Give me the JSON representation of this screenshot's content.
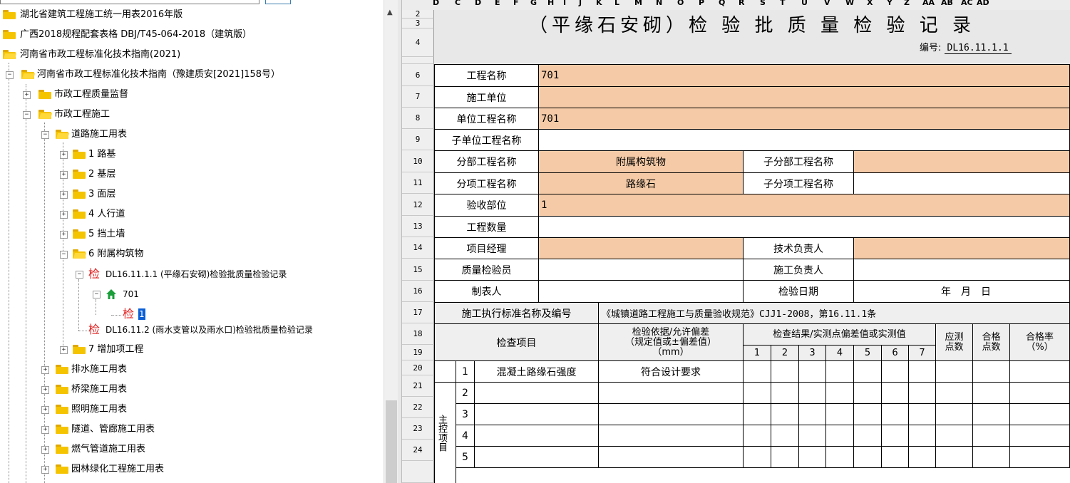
{
  "tree": {
    "items": [
      {
        "label": "湖北省建筑工程施工统一用表2016年版"
      },
      {
        "label": "广西2018规程配套表格 DBJ/T45-064-2018（建筑版）"
      },
      {
        "label": "河南省市政工程标准化技术指南(2021)"
      },
      {
        "label": "河南省市政工程标准化技术指南（豫建质安[2021]158号）"
      },
      {
        "label": "市政工程质量监督"
      },
      {
        "label": "市政工程施工"
      },
      {
        "label": "道路施工用表"
      },
      {
        "label": "1 路基"
      },
      {
        "label": "2 基层"
      },
      {
        "label": "3 面层"
      },
      {
        "label": "4 人行道"
      },
      {
        "label": "5 挡土墙"
      },
      {
        "label": "6 附属构筑物"
      },
      {
        "label": "DL16.11.1.1 (平缘石安砌)检验批质量检验记录"
      },
      {
        "label": "701"
      },
      {
        "label": "1"
      },
      {
        "label": "DL16.11.2 (雨水支管以及雨水口)检验批质量检验记录"
      },
      {
        "label": "7 增加项工程"
      },
      {
        "label": "排水施工用表"
      },
      {
        "label": "桥梁施工用表"
      },
      {
        "label": "照明施工用表"
      },
      {
        "label": "隧道、管廊施工用表"
      },
      {
        "label": "燃气管道施工用表"
      },
      {
        "label": "园林绿化工程施工用表"
      }
    ],
    "jian": "检"
  },
  "sheet": {
    "col_letters": [
      "D",
      "C",
      "D",
      "E",
      "F",
      "G",
      "H",
      "I",
      "J",
      "K",
      "L",
      "M",
      "N",
      "O",
      "P",
      "Q",
      "R",
      "S",
      "T",
      "U",
      "V",
      "W",
      "X",
      "Y",
      "Z",
      "AA",
      "AB",
      "AC",
      "AD"
    ],
    "row_numbers": [
      "2",
      "3",
      "4",
      "6",
      "7",
      "8",
      "9",
      "10",
      "11",
      "12",
      "13",
      "14",
      "15",
      "16",
      "17",
      "18",
      "19",
      "20",
      "21",
      "22",
      "23",
      "24"
    ],
    "title": "（平缘石安砌）检 验 批 质 量 检 验 记 录",
    "bianhao_label": "编号:",
    "bianhao_value": "DL16.11.1.1",
    "rows": {
      "gcmc": {
        "label": "工程名称",
        "value": "701"
      },
      "sgdw": {
        "label": "施工单位",
        "value": ""
      },
      "dwgc": {
        "label": "单位工程名称",
        "value": "701"
      },
      "zdw": {
        "label": "子单位工程名称",
        "value": ""
      },
      "fb": {
        "label": "分部工程名称",
        "value": "附属构筑物",
        "label2": "子分部工程名称"
      },
      "fx": {
        "label": "分项工程名称",
        "value": "路缘石",
        "label2": "子分项工程名称"
      },
      "ys": {
        "label": "验收部位",
        "value": "1"
      },
      "sl": {
        "label": "工程数量",
        "value": ""
      },
      "xm": {
        "label": "项目经理",
        "label2": "技术负责人"
      },
      "zl": {
        "label": "质量检验员",
        "label2": "施工负责人"
      },
      "zb": {
        "label": "制表人",
        "label2": "检验日期",
        "date": "年　月　日"
      },
      "bz": {
        "label": "施工执行标准名称及编号",
        "value": "《城镇道路工程施工与质量验收规范》CJJ1-2008，第16.11.1条"
      }
    },
    "header": {
      "jcxm": "检查项目",
      "yiju": "检验依据/允许偏差",
      "yiju2": "（规定值或±偏差值）",
      "unit": "（mm）",
      "result": "检查结果/实测点偏差值或实测值",
      "points": [
        "1",
        "2",
        "3",
        "4",
        "5",
        "6",
        "7"
      ],
      "ycds": "应测点数",
      "hgds": "合格点数",
      "hgl": "合格率",
      "pct": "（%）"
    },
    "zhukong": "主控项目",
    "items": [
      {
        "no": "1",
        "name": "混凝土路缘石强度",
        "req": "符合设计要求"
      },
      {
        "no": "2",
        "name": "",
        "req": ""
      },
      {
        "no": "3",
        "name": "",
        "req": ""
      },
      {
        "no": "4",
        "name": "",
        "req": ""
      },
      {
        "no": "5",
        "name": "",
        "req": ""
      }
    ]
  }
}
